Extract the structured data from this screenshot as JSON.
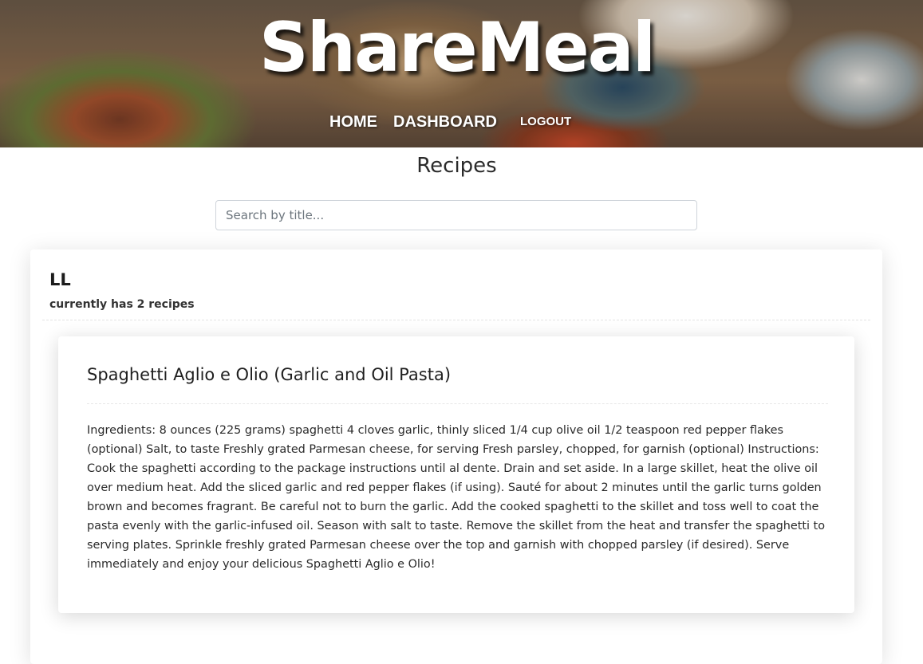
{
  "brand": {
    "logo_text": "ShareMeal"
  },
  "nav": {
    "home_label": "HOME",
    "dashboard_label": "DASHBOARD",
    "logout_label": "LOGOUT"
  },
  "page": {
    "title": "Recipes"
  },
  "search": {
    "placeholder": "Search by title...",
    "value": ""
  },
  "users": [
    {
      "name": "LL",
      "count_text": "currently has 2 recipes",
      "recipes": [
        {
          "title": "Spaghetti Aglio e Olio (Garlic and Oil Pasta)",
          "body": "Ingredients: 8 ounces (225 grams) spaghetti 4 cloves garlic, thinly sliced 1/4 cup olive oil 1/2 teaspoon red pepper flakes (optional) Salt, to taste Freshly grated Parmesan cheese, for serving Fresh parsley, chopped, for garnish (optional) Instructions: Cook the spaghetti according to the package instructions until al dente. Drain and set aside. In a large skillet, heat the olive oil over medium heat. Add the sliced garlic and red pepper flakes (if using). Sauté for about 2 minutes until the garlic turns golden brown and becomes fragrant. Be careful not to burn the garlic. Add the cooked spaghetti to the skillet and toss well to coat the pasta evenly with the garlic-infused oil. Season with salt to taste. Remove the skillet from the heat and transfer the spaghetti to serving plates. Sprinkle freshly grated Parmesan cheese over the top and garnish with chopped parsley (if desired). Serve immediately and enjoy your delicious Spaghetti Aglio e Olio!"
        }
      ]
    }
  ]
}
